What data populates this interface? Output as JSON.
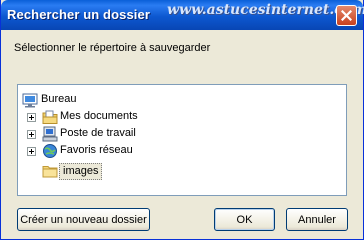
{
  "window": {
    "title": "Rechercher un dossier",
    "watermark": "www.astucesinternet.com"
  },
  "dialog": {
    "instruction": "Sélectionner le répertoire à sauvegarder"
  },
  "tree": {
    "root": {
      "label": "Bureau",
      "icon": "desktop-icon"
    },
    "items": [
      {
        "label": "Mes documents",
        "icon": "my-documents-icon",
        "expandable": true
      },
      {
        "label": "Poste de travail",
        "icon": "my-computer-icon",
        "expandable": true
      },
      {
        "label": "Favoris réseau",
        "icon": "network-places-icon",
        "expandable": true
      },
      {
        "label": "images",
        "icon": "folder-icon",
        "expandable": false,
        "selected": true
      }
    ]
  },
  "buttons": {
    "new_folder": "Créer un nouveau dossier",
    "ok": "OK",
    "cancel": "Annuler"
  },
  "colors": {
    "title_bar": "#0a5fd8",
    "dialog_bg": "#ece9d8",
    "close_button": "#c8411f"
  }
}
